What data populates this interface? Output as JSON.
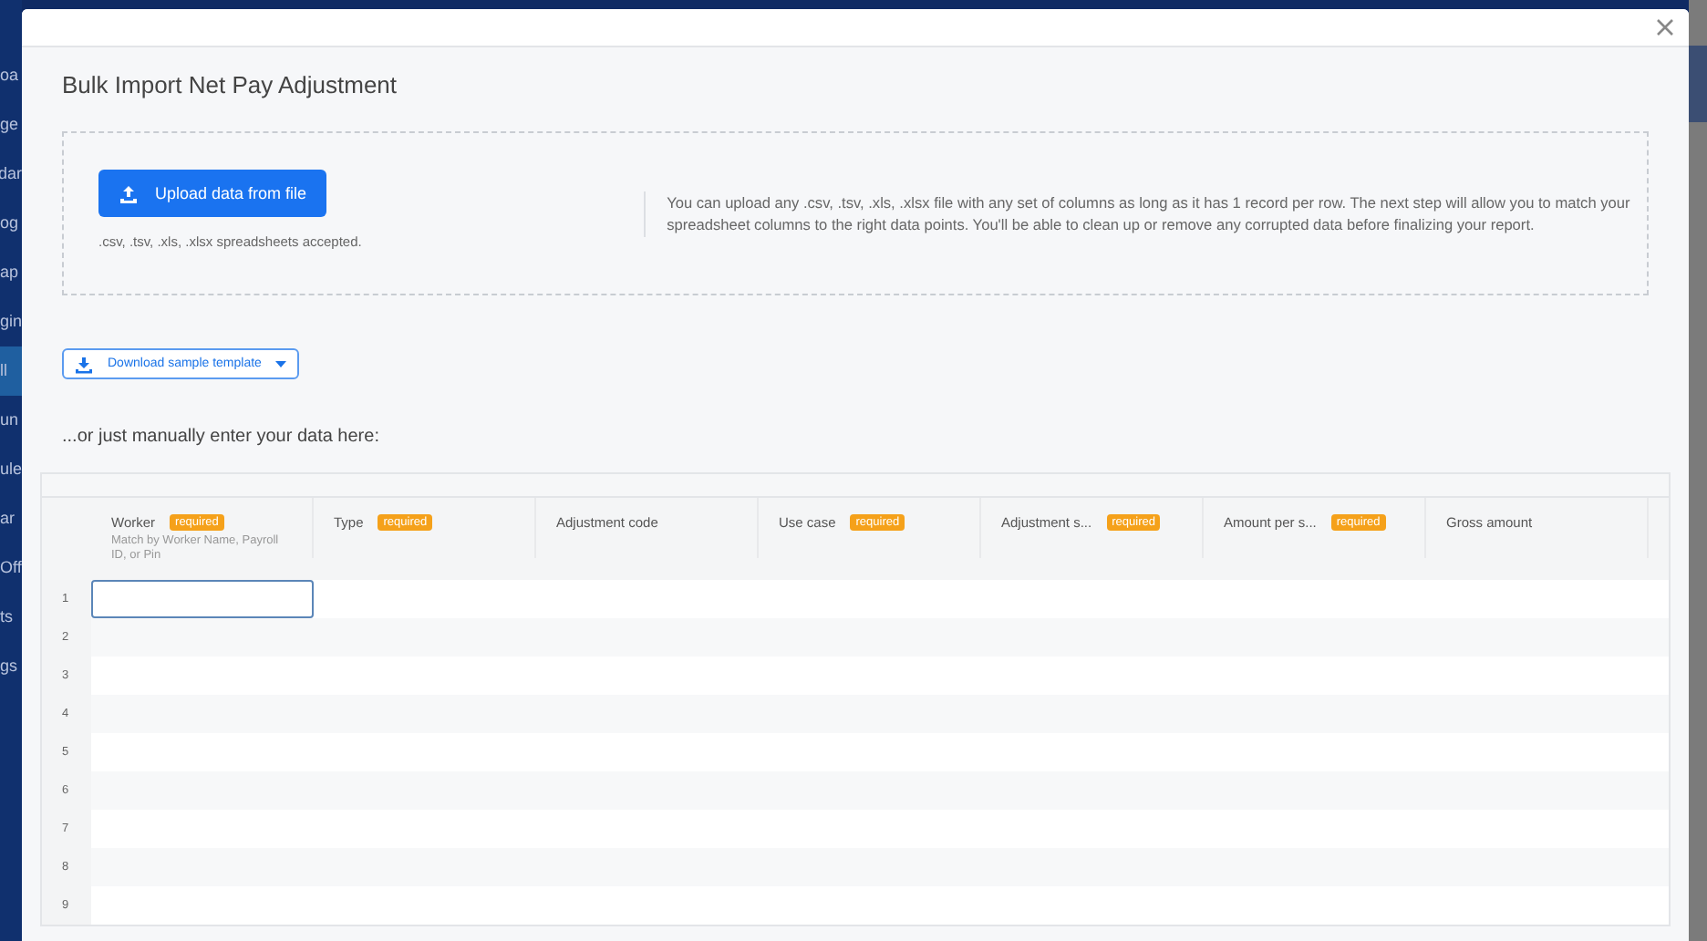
{
  "sidebar": {
    "items": [
      {
        "label": "oa",
        "selected": false
      },
      {
        "label": "ge",
        "selected": false
      },
      {
        "label": "dar",
        "selected": false
      },
      {
        "label": "og",
        "selected": false
      },
      {
        "label": "ap",
        "selected": false
      },
      {
        "label": "gin",
        "selected": false
      },
      {
        "label": "ll",
        "selected": true
      },
      {
        "label": "un",
        "selected": false
      },
      {
        "label": "ule",
        "selected": false
      },
      {
        "label": "ar",
        "selected": false
      },
      {
        "label": "Off",
        "selected": false
      },
      {
        "label": "ts",
        "selected": false
      },
      {
        "label": "gs",
        "selected": false
      }
    ]
  },
  "modal": {
    "title": "Bulk Import Net Pay Adjustment",
    "upload": {
      "button": "Upload data from file",
      "accepted": ".csv, .tsv, .xls, .xlsx spreadsheets accepted.",
      "description": "You can upload any .csv, .tsv, .xls, .xlsx file with any set of columns as long as it has 1 record per row. The next step will allow you to match your spreadsheet columns to the right data points. You'll be able to clean up or remove any corrupted data before finalizing your report."
    },
    "download_button": "Download sample template",
    "manual_heading": "...or just manually enter your data here:",
    "table": {
      "columns": [
        {
          "label": "Worker",
          "badge": "required",
          "hint": "Match by Worker Name, Payroll ID, or Pin"
        },
        {
          "label": "Type",
          "badge": "required"
        },
        {
          "label": "Adjustment code"
        },
        {
          "label": "Use case",
          "badge": "required"
        },
        {
          "label": "Adjustment s...",
          "badge": "required"
        },
        {
          "label": "Amount per s...",
          "badge": "required"
        },
        {
          "label": "Gross amount"
        }
      ],
      "rows": [
        {
          "number": "1",
          "focused": true
        },
        {
          "number": "2",
          "focused": false
        },
        {
          "number": "3",
          "focused": false
        },
        {
          "number": "4",
          "focused": false
        },
        {
          "number": "5",
          "focused": false
        },
        {
          "number": "6",
          "focused": false
        },
        {
          "number": "7",
          "focused": false
        },
        {
          "number": "8",
          "focused": false
        },
        {
          "number": "9",
          "focused": false
        }
      ]
    }
  }
}
